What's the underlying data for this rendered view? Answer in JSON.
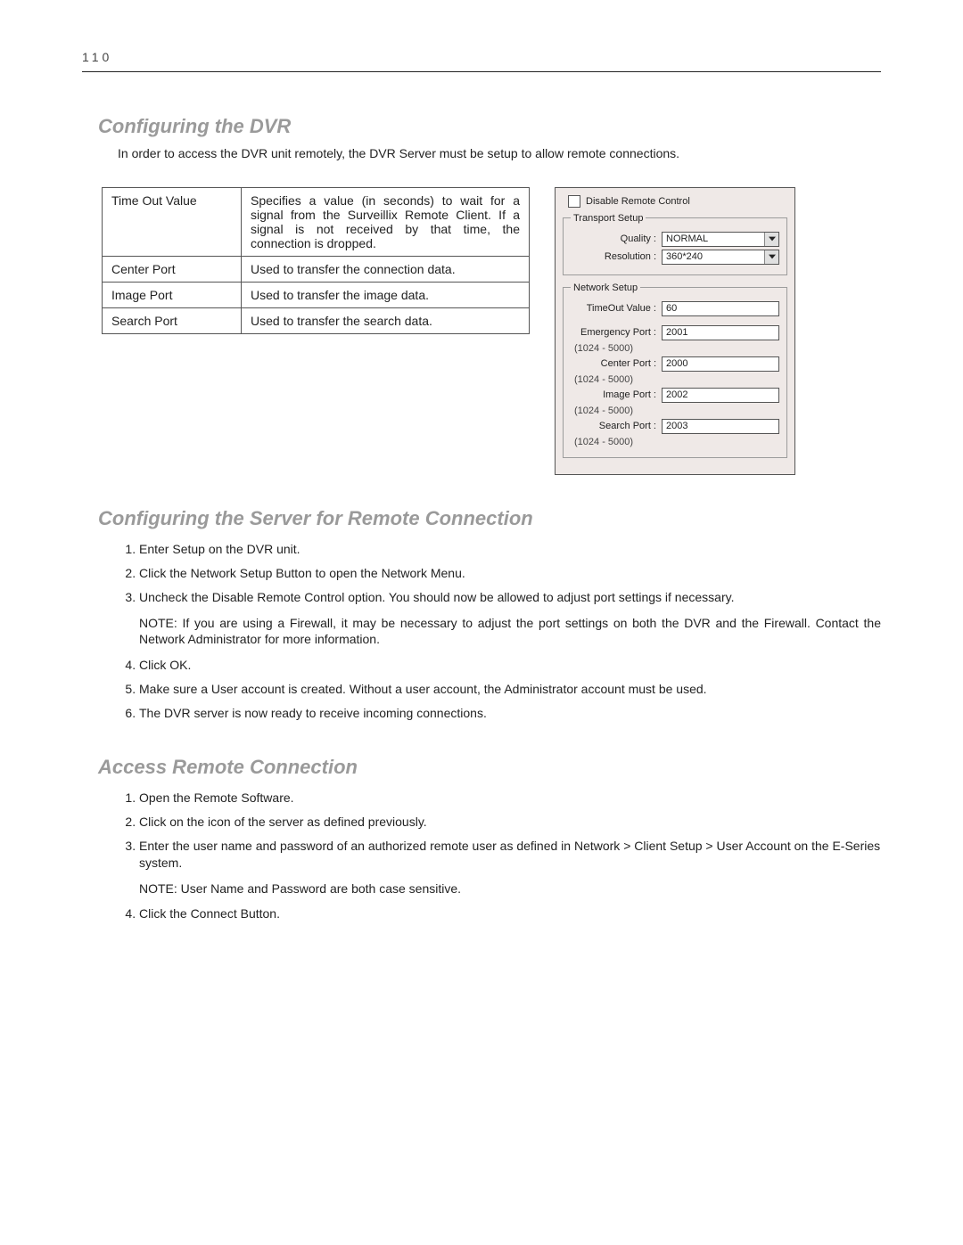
{
  "page_number": "110",
  "sections": {
    "config_dvr": {
      "heading": "Configuring the DVR",
      "intro": "In order to access the DVR unit remotely, the DVR Server must be setup to allow remote connections.",
      "table": {
        "rows": [
          {
            "term": "Time Out Value",
            "desc": "Specifies a value (in seconds) to wait for a signal from the Surveillix Remote Client.  If a signal is not received by that time, the connection is dropped."
          },
          {
            "term": "Center Port",
            "desc": "Used to transfer the connection data."
          },
          {
            "term": "Image Port",
            "desc": "Used to transfer the image data."
          },
          {
            "term": "Search Port",
            "desc": "Used to transfer the search data."
          }
        ]
      }
    },
    "config_server": {
      "heading": "Configuring the Server for Remote Connection",
      "steps_a": [
        "Enter Setup on the DVR unit.",
        "Click the Network Setup Button to open the Network Menu.",
        "Uncheck the Disable Remote Control option. You should now be allowed to adjust port settings if necessary."
      ],
      "note_a": "NOTE:  If you are using a Firewall, it may be necessary to adjust the port settings on both the DVR and the Firewall.  Contact the Network Administrator for more information.",
      "steps_b": [
        "Click OK.",
        "Make sure a User account is created. Without a user account, the Administrator account must be used.",
        "The DVR server is now ready to receive incoming connections."
      ]
    },
    "access_remote": {
      "heading": "Access Remote Connection",
      "steps_a": [
        "Open the Remote Software.",
        "Click on the icon of the server as defined previously.",
        "Enter the user name and password of an authorized remote user as defined in Network > Client Setup > User Account on the E-Series system."
      ],
      "note_a": "NOTE: User Name and Password are both case sensitive.",
      "steps_b": [
        "Click the Connect Button."
      ]
    }
  },
  "panel": {
    "disable_remote": "Disable Remote Control",
    "transport_legend": "Transport Setup",
    "network_legend": "Network Setup",
    "labels": {
      "quality": "Quality :",
      "resolution": "Resolution :",
      "timeout": "TimeOut Value :",
      "emergency": "Emergency Port :",
      "center": "Center Port :",
      "image": "Image Port :",
      "search": "Search Port :",
      "range": "(1024 - 5000)"
    },
    "values": {
      "quality": "NORMAL",
      "resolution": "360*240",
      "timeout": "60",
      "emergency": "2001",
      "center": "2000",
      "image": "2002",
      "search": "2003"
    }
  }
}
